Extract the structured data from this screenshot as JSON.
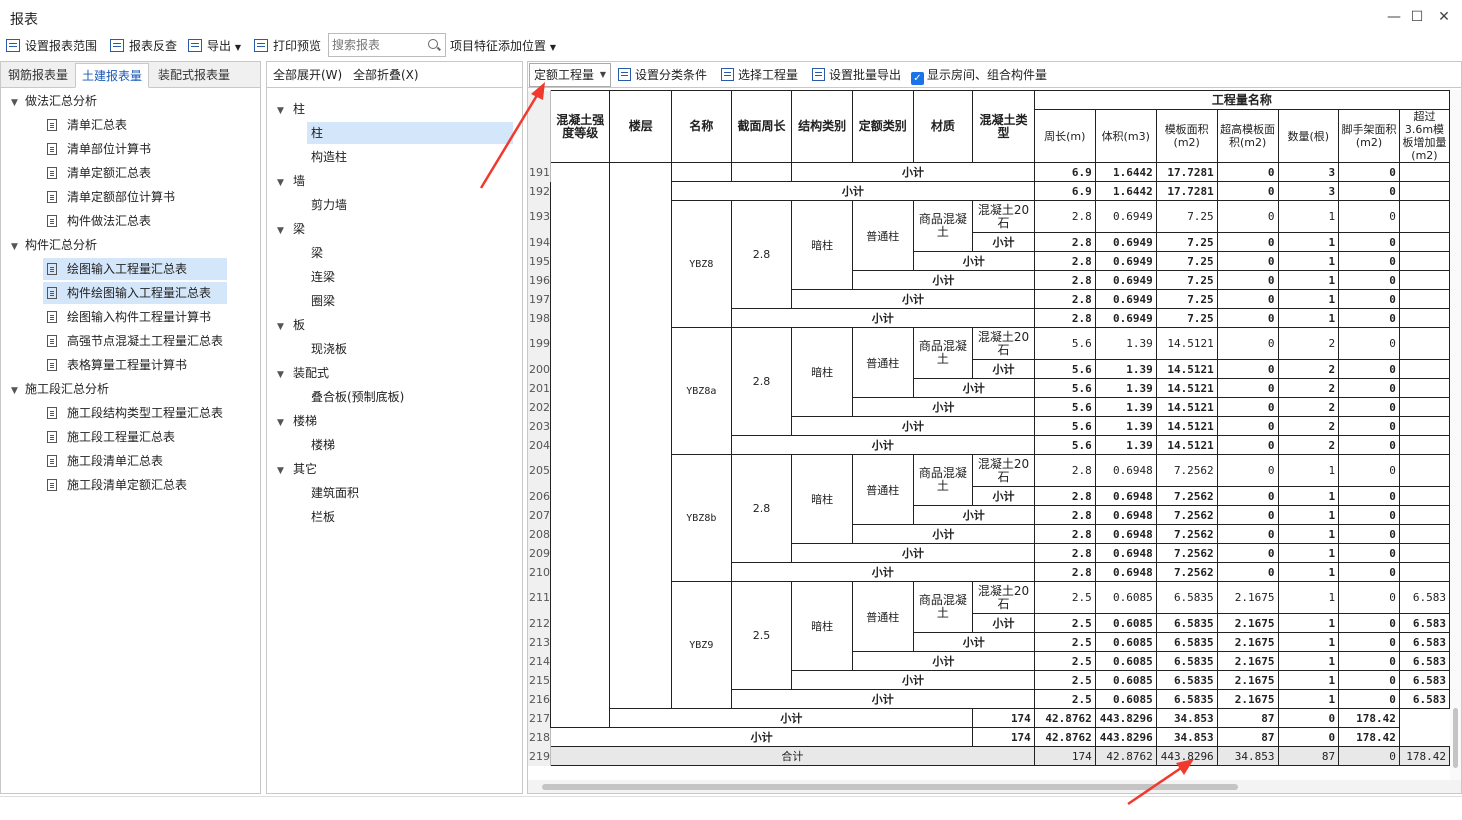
{
  "window": {
    "title": "报表"
  },
  "toolbar": {
    "set_range": "设置报表范围",
    "reverse": "报表反查",
    "export": "导出",
    "print_preview": "打印预览",
    "search_placeholder": "搜索报表",
    "feature_position": "项目特征添加位置"
  },
  "tabs": [
    "钢筋报表量",
    "土建报表量",
    "装配式报表量"
  ],
  "tree": {
    "g1": "做法汇总分析",
    "g1_items": [
      "清单汇总表",
      "清单部位计算书",
      "清单定额汇总表",
      "清单定额部位计算书",
      "构件做法汇总表"
    ],
    "g2": "构件汇总分析",
    "g2_items": [
      "绘图输入工程量汇总表",
      "构件绘图输入工程量汇总表",
      "绘图输入构件工程量计算书",
      "高强节点混凝土工程量汇总表",
      "表格算量工程量计算书"
    ],
    "g3": "施工段汇总分析",
    "g3_items": [
      "施工段结构类型工程量汇总表",
      "施工段工程量汇总表",
      "施工段清单汇总表",
      "施工段清单定额汇总表"
    ]
  },
  "mid": {
    "expand_all": "全部展开(W)",
    "collapse_all": "全部折叠(X)",
    "items": [
      {
        "label": "柱",
        "level": 0
      },
      {
        "label": "柱",
        "level": 1
      },
      {
        "label": "构造柱",
        "level": 1
      },
      {
        "label": "墙",
        "level": 0
      },
      {
        "label": "剪力墙",
        "level": 1
      },
      {
        "label": "梁",
        "level": 0
      },
      {
        "label": "梁",
        "level": 1
      },
      {
        "label": "连梁",
        "level": 1
      },
      {
        "label": "圈梁",
        "level": 1
      },
      {
        "label": "板",
        "level": 0
      },
      {
        "label": "现浇板",
        "level": 1
      },
      {
        "label": "装配式",
        "level": 0
      },
      {
        "label": "叠合板(预制底板)",
        "level": 1
      },
      {
        "label": "楼梯",
        "level": 0
      },
      {
        "label": "楼梯",
        "level": 1
      },
      {
        "label": "其它",
        "level": 0
      },
      {
        "label": "建筑面积",
        "level": 1
      },
      {
        "label": "栏板",
        "level": 1
      }
    ]
  },
  "report_toolbar": {
    "mode": "定额工程量",
    "classify": "设置分类条件",
    "select_qty": "选择工程量",
    "batch_export": "设置批量导出",
    "show_rooms": "显示房间、组合构件量"
  },
  "grid": {
    "headers": {
      "grade": "混凝土强度等级",
      "floor": "楼层",
      "name": "名称",
      "perimeter": "截面周长",
      "struct_type": "结构类别",
      "quota_type": "定额类别",
      "material": "材质",
      "concrete_type": "混凝土类型",
      "qty_name": "工程量名称",
      "q_perimeter": "周长(m)",
      "q_volume": "体积(m3)",
      "q_formwork": "模板面积(m2)",
      "q_super": "超高模板面积(m2)",
      "q_count": "数量(根)",
      "q_scaffold": "脚手架面积(m2)",
      "q_over36": "超过3.6m模板增加量(m2)"
    },
    "labels": {
      "subtotal": "小计",
      "total": "合计",
      "dark_column": "暗柱",
      "normal_column": "普通柱",
      "commercial_concrete": "商品混凝土",
      "stone20": "混凝土20石"
    },
    "rows": {
      "r191": {
        "rn": "191",
        "v": [
          "6.9",
          "1.6442",
          "17.7281",
          "0",
          "3",
          "0",
          ""
        ]
      },
      "r192": {
        "rn": "192",
        "v": [
          "6.9",
          "1.6442",
          "17.7281",
          "0",
          "3",
          "0",
          ""
        ]
      },
      "ybz8": {
        "name": "YBZ8",
        "perim": "2.8",
        "rows": [
          {
            "rn": "193",
            "v": [
              "2.8",
              "0.6949",
              "7.25",
              "0",
              "1",
              "0",
              ""
            ]
          },
          {
            "rn": "194",
            "v": [
              "2.8",
              "0.6949",
              "7.25",
              "0",
              "1",
              "0",
              ""
            ]
          },
          {
            "rn": "195",
            "v": [
              "2.8",
              "0.6949",
              "7.25",
              "0",
              "1",
              "0",
              ""
            ]
          },
          {
            "rn": "196",
            "v": [
              "2.8",
              "0.6949",
              "7.25",
              "0",
              "1",
              "0",
              ""
            ]
          },
          {
            "rn": "197",
            "v": [
              "2.8",
              "0.6949",
              "7.25",
              "0",
              "1",
              "0",
              ""
            ]
          },
          {
            "rn": "198",
            "v": [
              "2.8",
              "0.6949",
              "7.25",
              "0",
              "1",
              "0",
              ""
            ]
          }
        ]
      },
      "ybz8a": {
        "name": "YBZ8a",
        "perim": "2.8",
        "rows": [
          {
            "rn": "199",
            "v": [
              "5.6",
              "1.39",
              "14.5121",
              "0",
              "2",
              "0",
              ""
            ]
          },
          {
            "rn": "200",
            "v": [
              "5.6",
              "1.39",
              "14.5121",
              "0",
              "2",
              "0",
              ""
            ]
          },
          {
            "rn": "201",
            "v": [
              "5.6",
              "1.39",
              "14.5121",
              "0",
              "2",
              "0",
              ""
            ]
          },
          {
            "rn": "202",
            "v": [
              "5.6",
              "1.39",
              "14.5121",
              "0",
              "2",
              "0",
              ""
            ]
          },
          {
            "rn": "203",
            "v": [
              "5.6",
              "1.39",
              "14.5121",
              "0",
              "2",
              "0",
              ""
            ]
          },
          {
            "rn": "204",
            "v": [
              "5.6",
              "1.39",
              "14.5121",
              "0",
              "2",
              "0",
              ""
            ]
          }
        ]
      },
      "ybz8b": {
        "name": "YBZ8b",
        "perim": "2.8",
        "rows": [
          {
            "rn": "205",
            "v": [
              "2.8",
              "0.6948",
              "7.2562",
              "0",
              "1",
              "0",
              ""
            ]
          },
          {
            "rn": "206",
            "v": [
              "2.8",
              "0.6948",
              "7.2562",
              "0",
              "1",
              "0",
              ""
            ]
          },
          {
            "rn": "207",
            "v": [
              "2.8",
              "0.6948",
              "7.2562",
              "0",
              "1",
              "0",
              ""
            ]
          },
          {
            "rn": "208",
            "v": [
              "2.8",
              "0.6948",
              "7.2562",
              "0",
              "1",
              "0",
              ""
            ]
          },
          {
            "rn": "209",
            "v": [
              "2.8",
              "0.6948",
              "7.2562",
              "0",
              "1",
              "0",
              ""
            ]
          },
          {
            "rn": "210",
            "v": [
              "2.8",
              "0.6948",
              "7.2562",
              "0",
              "1",
              "0",
              ""
            ]
          }
        ]
      },
      "ybz9": {
        "name": "YBZ9",
        "perim": "2.5",
        "rows": [
          {
            "rn": "211",
            "v": [
              "2.5",
              "0.6085",
              "6.5835",
              "2.1675",
              "1",
              "0",
              "6.583"
            ]
          },
          {
            "rn": "212",
            "v": [
              "2.5",
              "0.6085",
              "6.5835",
              "2.1675",
              "1",
              "0",
              "6.583"
            ]
          },
          {
            "rn": "213",
            "v": [
              "2.5",
              "0.6085",
              "6.5835",
              "2.1675",
              "1",
              "0",
              "6.583"
            ]
          },
          {
            "rn": "214",
            "v": [
              "2.5",
              "0.6085",
              "6.5835",
              "2.1675",
              "1",
              "0",
              "6.583"
            ]
          },
          {
            "rn": "215",
            "v": [
              "2.5",
              "0.6085",
              "6.5835",
              "2.1675",
              "1",
              "0",
              "6.583"
            ]
          },
          {
            "rn": "216",
            "v": [
              "2.5",
              "0.6085",
              "6.5835",
              "2.1675",
              "1",
              "0",
              "6.583"
            ]
          }
        ]
      },
      "r217": {
        "rn": "217",
        "v": [
          "174",
          "42.8762",
          "443.8296",
          "34.853",
          "87",
          "0",
          "178.42"
        ]
      },
      "r218": {
        "rn": "218",
        "v": [
          "174",
          "42.8762",
          "443.8296",
          "34.853",
          "87",
          "0",
          "178.42"
        ]
      },
      "r219": {
        "rn": "219",
        "v": [
          "174",
          "42.8762",
          "443.8296",
          "34.853",
          "87",
          "0",
          "178.42"
        ]
      }
    }
  },
  "colors": {
    "accent": "#1a73e8",
    "selection": "#d4e6fa",
    "arrow": "#f03a2e"
  }
}
